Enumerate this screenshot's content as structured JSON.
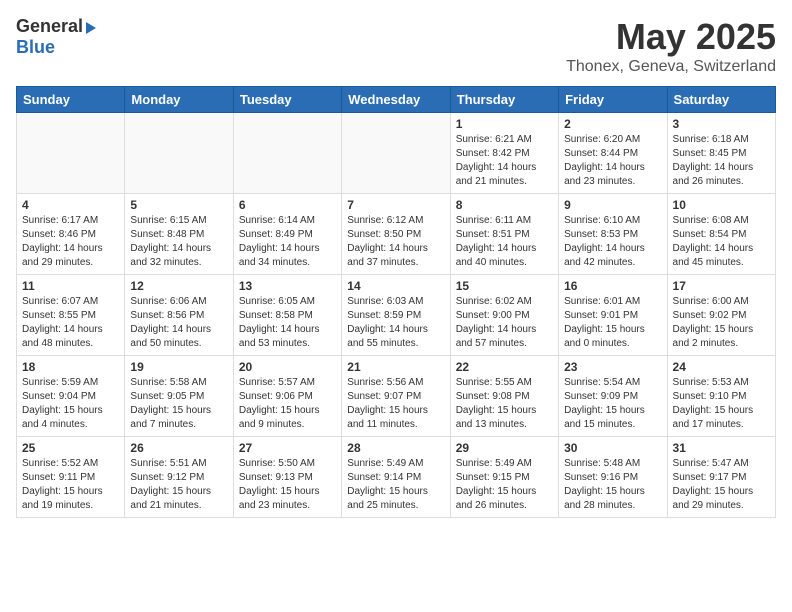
{
  "header": {
    "logo_line1": "General",
    "logo_line2": "Blue",
    "title": "May 2025",
    "subtitle": "Thonex, Geneva, Switzerland"
  },
  "days_of_week": [
    "Sunday",
    "Monday",
    "Tuesday",
    "Wednesday",
    "Thursday",
    "Friday",
    "Saturday"
  ],
  "weeks": [
    [
      {
        "day": "",
        "info": ""
      },
      {
        "day": "",
        "info": ""
      },
      {
        "day": "",
        "info": ""
      },
      {
        "day": "",
        "info": ""
      },
      {
        "day": "1",
        "info": "Sunrise: 6:21 AM\nSunset: 8:42 PM\nDaylight: 14 hours\nand 21 minutes."
      },
      {
        "day": "2",
        "info": "Sunrise: 6:20 AM\nSunset: 8:44 PM\nDaylight: 14 hours\nand 23 minutes."
      },
      {
        "day": "3",
        "info": "Sunrise: 6:18 AM\nSunset: 8:45 PM\nDaylight: 14 hours\nand 26 minutes."
      }
    ],
    [
      {
        "day": "4",
        "info": "Sunrise: 6:17 AM\nSunset: 8:46 PM\nDaylight: 14 hours\nand 29 minutes."
      },
      {
        "day": "5",
        "info": "Sunrise: 6:15 AM\nSunset: 8:48 PM\nDaylight: 14 hours\nand 32 minutes."
      },
      {
        "day": "6",
        "info": "Sunrise: 6:14 AM\nSunset: 8:49 PM\nDaylight: 14 hours\nand 34 minutes."
      },
      {
        "day": "7",
        "info": "Sunrise: 6:12 AM\nSunset: 8:50 PM\nDaylight: 14 hours\nand 37 minutes."
      },
      {
        "day": "8",
        "info": "Sunrise: 6:11 AM\nSunset: 8:51 PM\nDaylight: 14 hours\nand 40 minutes."
      },
      {
        "day": "9",
        "info": "Sunrise: 6:10 AM\nSunset: 8:53 PM\nDaylight: 14 hours\nand 42 minutes."
      },
      {
        "day": "10",
        "info": "Sunrise: 6:08 AM\nSunset: 8:54 PM\nDaylight: 14 hours\nand 45 minutes."
      }
    ],
    [
      {
        "day": "11",
        "info": "Sunrise: 6:07 AM\nSunset: 8:55 PM\nDaylight: 14 hours\nand 48 minutes."
      },
      {
        "day": "12",
        "info": "Sunrise: 6:06 AM\nSunset: 8:56 PM\nDaylight: 14 hours\nand 50 minutes."
      },
      {
        "day": "13",
        "info": "Sunrise: 6:05 AM\nSunset: 8:58 PM\nDaylight: 14 hours\nand 53 minutes."
      },
      {
        "day": "14",
        "info": "Sunrise: 6:03 AM\nSunset: 8:59 PM\nDaylight: 14 hours\nand 55 minutes."
      },
      {
        "day": "15",
        "info": "Sunrise: 6:02 AM\nSunset: 9:00 PM\nDaylight: 14 hours\nand 57 minutes."
      },
      {
        "day": "16",
        "info": "Sunrise: 6:01 AM\nSunset: 9:01 PM\nDaylight: 15 hours\nand 0 minutes."
      },
      {
        "day": "17",
        "info": "Sunrise: 6:00 AM\nSunset: 9:02 PM\nDaylight: 15 hours\nand 2 minutes."
      }
    ],
    [
      {
        "day": "18",
        "info": "Sunrise: 5:59 AM\nSunset: 9:04 PM\nDaylight: 15 hours\nand 4 minutes."
      },
      {
        "day": "19",
        "info": "Sunrise: 5:58 AM\nSunset: 9:05 PM\nDaylight: 15 hours\nand 7 minutes."
      },
      {
        "day": "20",
        "info": "Sunrise: 5:57 AM\nSunset: 9:06 PM\nDaylight: 15 hours\nand 9 minutes."
      },
      {
        "day": "21",
        "info": "Sunrise: 5:56 AM\nSunset: 9:07 PM\nDaylight: 15 hours\nand 11 minutes."
      },
      {
        "day": "22",
        "info": "Sunrise: 5:55 AM\nSunset: 9:08 PM\nDaylight: 15 hours\nand 13 minutes."
      },
      {
        "day": "23",
        "info": "Sunrise: 5:54 AM\nSunset: 9:09 PM\nDaylight: 15 hours\nand 15 minutes."
      },
      {
        "day": "24",
        "info": "Sunrise: 5:53 AM\nSunset: 9:10 PM\nDaylight: 15 hours\nand 17 minutes."
      }
    ],
    [
      {
        "day": "25",
        "info": "Sunrise: 5:52 AM\nSunset: 9:11 PM\nDaylight: 15 hours\nand 19 minutes."
      },
      {
        "day": "26",
        "info": "Sunrise: 5:51 AM\nSunset: 9:12 PM\nDaylight: 15 hours\nand 21 minutes."
      },
      {
        "day": "27",
        "info": "Sunrise: 5:50 AM\nSunset: 9:13 PM\nDaylight: 15 hours\nand 23 minutes."
      },
      {
        "day": "28",
        "info": "Sunrise: 5:49 AM\nSunset: 9:14 PM\nDaylight: 15 hours\nand 25 minutes."
      },
      {
        "day": "29",
        "info": "Sunrise: 5:49 AM\nSunset: 9:15 PM\nDaylight: 15 hours\nand 26 minutes."
      },
      {
        "day": "30",
        "info": "Sunrise: 5:48 AM\nSunset: 9:16 PM\nDaylight: 15 hours\nand 28 minutes."
      },
      {
        "day": "31",
        "info": "Sunrise: 5:47 AM\nSunset: 9:17 PM\nDaylight: 15 hours\nand 29 minutes."
      }
    ]
  ]
}
